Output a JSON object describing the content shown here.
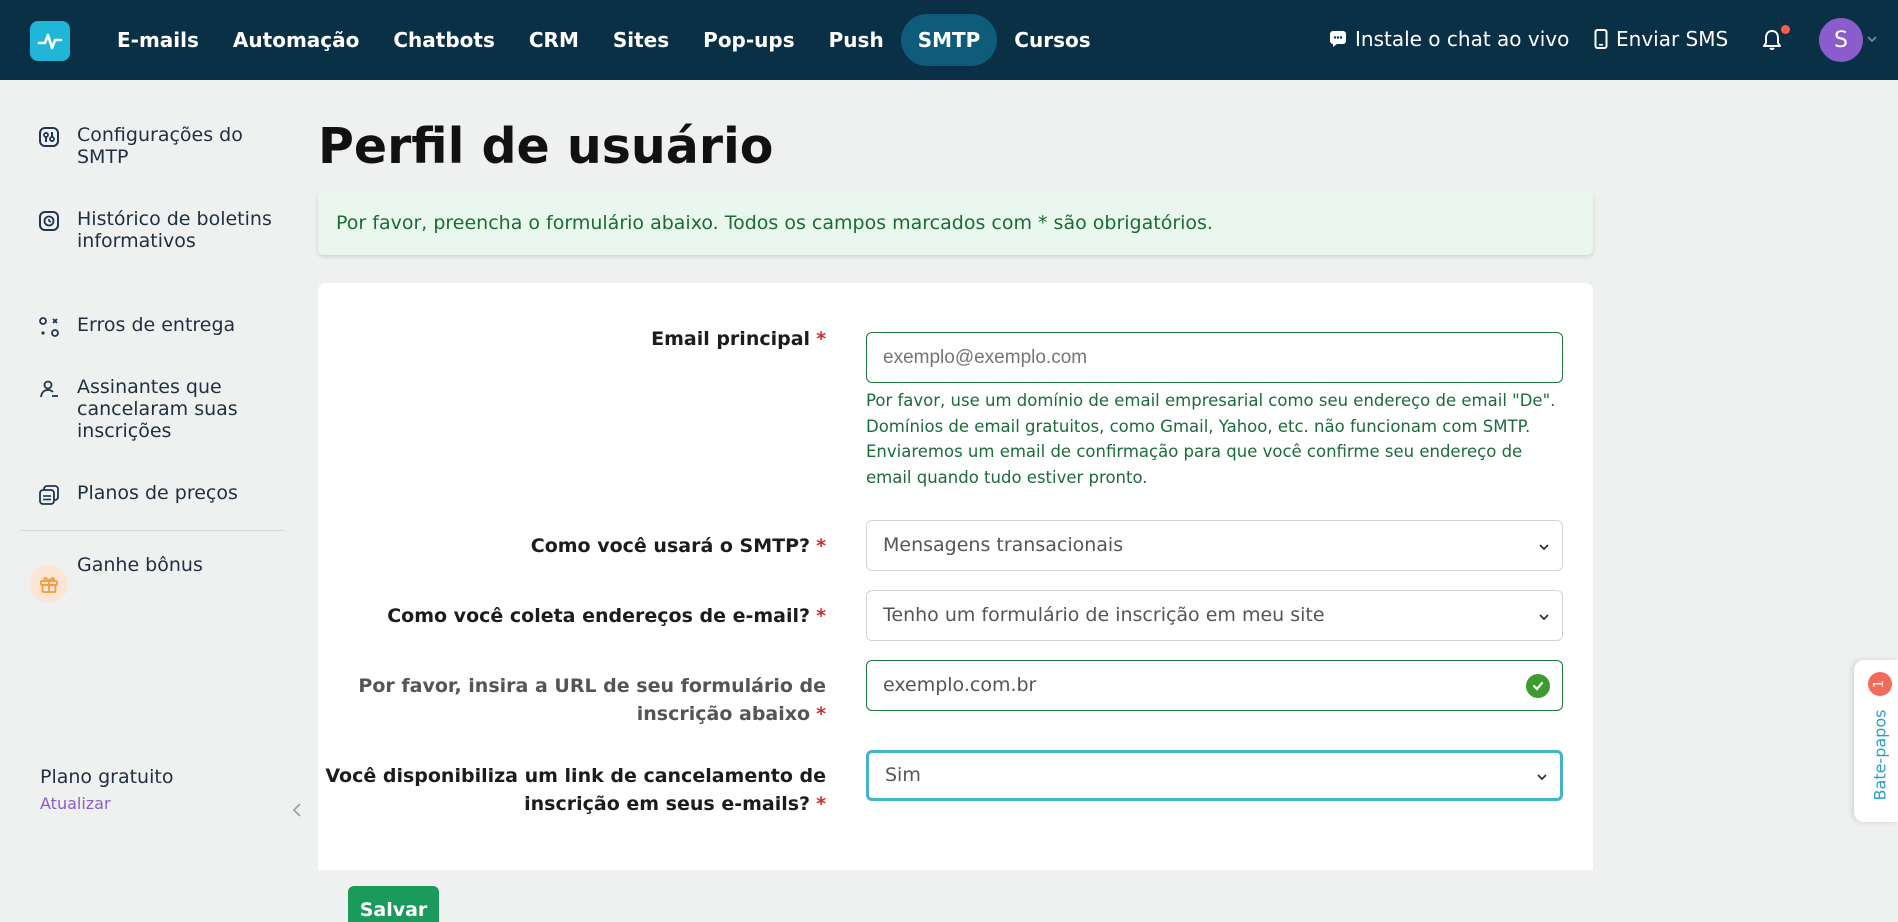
{
  "nav": {
    "items": [
      "E-mails",
      "Automação",
      "Chatbots",
      "CRM",
      "Sites",
      "Pop-ups",
      "Push",
      "SMTP",
      "Cursos"
    ],
    "active": "SMTP",
    "live_chat": "Instale o chat ao vivo",
    "sms": "Enviar SMS",
    "avatar_letter": "S"
  },
  "sidebar": {
    "items": [
      {
        "label": "Configurações do SMTP",
        "icon": "settings-icon"
      },
      {
        "label": "Histórico de boletins informativos",
        "icon": "history-icon"
      },
      {
        "label": "Erros de entrega",
        "icon": "delivery-errors-icon"
      },
      {
        "label": "Assinantes que cancelaram suas inscrições",
        "icon": "unsubscribed-user-icon"
      },
      {
        "label": "Planos de preços",
        "icon": "pricing-plans-icon"
      },
      {
        "label": "Ganhe bônus",
        "icon": "gift-icon"
      }
    ],
    "plan": "Plano gratuito",
    "upgrade": "Atualizar"
  },
  "page": {
    "title": "Perfil de usuário",
    "notice": "Por favor, preencha o formulário abaixo. Todos os campos marcados com * são obrigatórios."
  },
  "form": {
    "email_label": "Email principal",
    "email_placeholder": "exemplo@exemplo.com",
    "email_hint": "Por favor, use um domínio de email empresarial como seu endereço de email \"De\". Domínios de email gratuitos, como Gmail, Yahoo, etc. não funcionam com SMTP. Enviaremos um email de confirmação para que você confirme seu endereço de email quando tudo estiver pronto.",
    "usage_label": "Como você usará o SMTP?",
    "usage_value": "Mensagens transacionais",
    "collect_label": "Como você coleta endereços de e-mail?",
    "collect_value": "Tenho um formulário de inscrição em meu site",
    "url_label": "Por favor, insira a URL de seu formulário de inscrição abaixo",
    "url_value": "exemplo.com.br",
    "unsub_label": "Você disponibiliza um link de cancelamento de inscrição em seus e-mails?",
    "unsub_value": "Sim",
    "required_mark": "*",
    "save": "Salvar"
  },
  "chat_widget": {
    "label": "Bate-papos",
    "badge": "1"
  },
  "colors": {
    "topbar": "#0a3046",
    "active_nav": "#0e5c7a",
    "accent_green": "#1a9a5b",
    "avatar": "#8b5ccb",
    "required": "#d12c2c"
  }
}
